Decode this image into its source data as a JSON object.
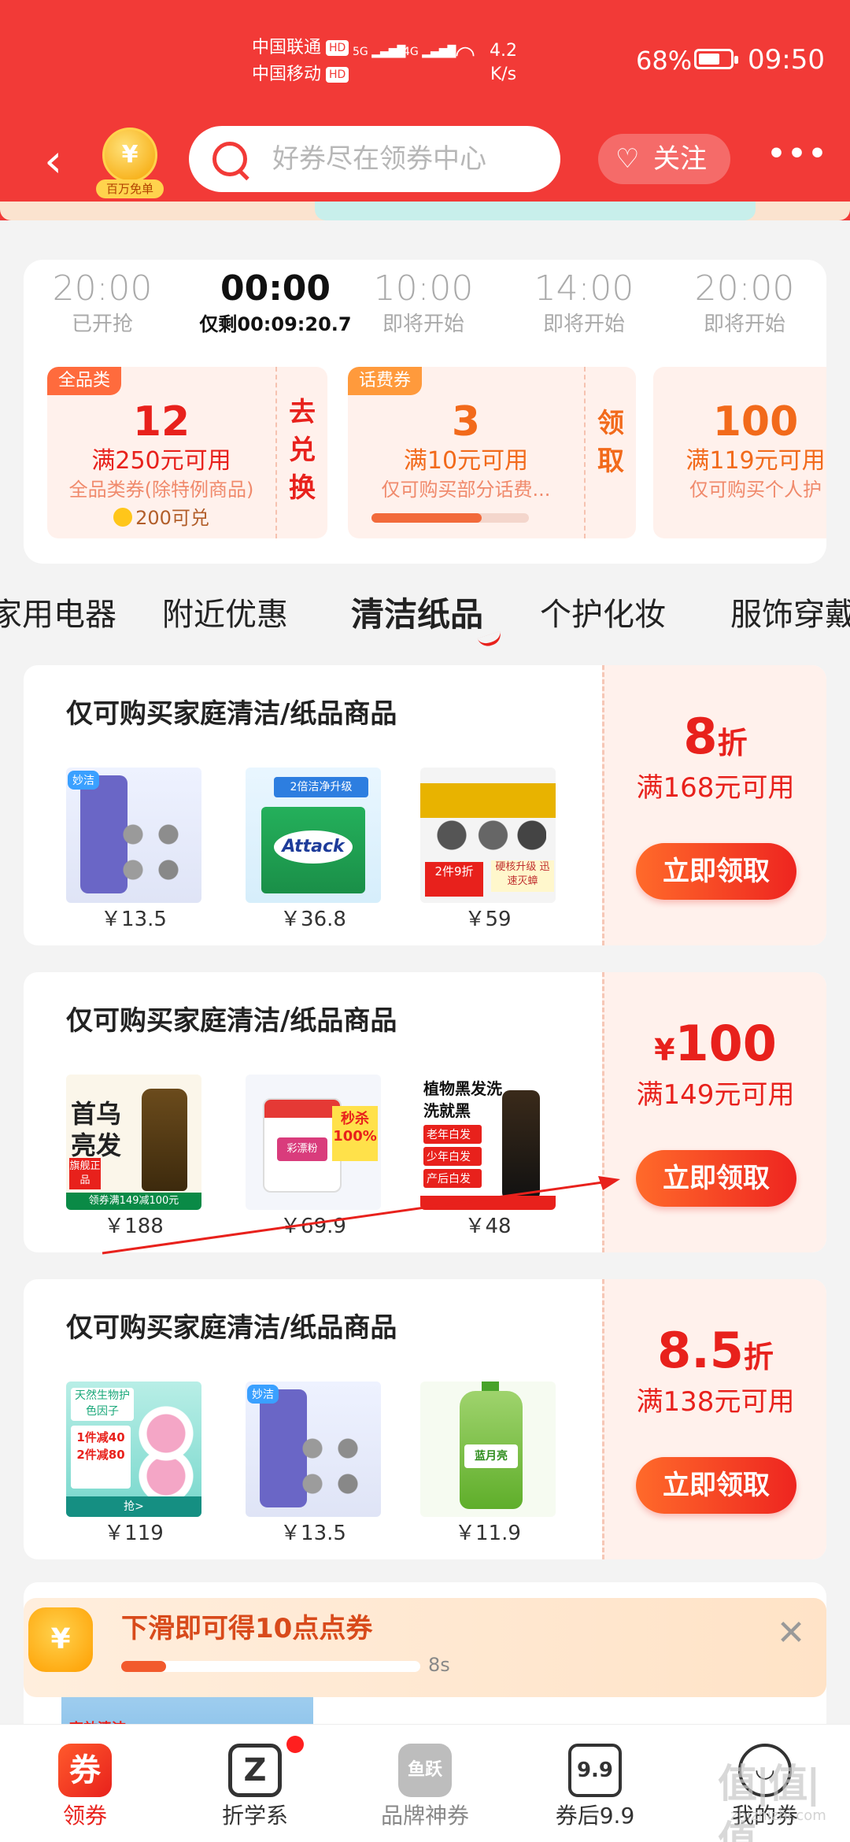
{
  "status": {
    "carrier1": "中国联通",
    "carrier2": "中国移动",
    "hd": "HD",
    "net5g": "5G",
    "net4g": "4G",
    "speed": "4.2",
    "speed_unit": "K/s",
    "battery": "68%",
    "time": "09:50"
  },
  "nav": {
    "badge_label": "百万免单",
    "badge_symbol": "¥",
    "search_placeholder": "好券尽在领券中心",
    "follow_label": "关注",
    "more_label": "•••"
  },
  "flash": {
    "slots": [
      {
        "time": "20:00",
        "status": "已开抢"
      },
      {
        "time": "00:00",
        "status": "仅剩00:09:20.7"
      },
      {
        "time": "10:00",
        "status": "即将开始"
      },
      {
        "time": "14:00",
        "status": "即将开始"
      },
      {
        "time": "20:00",
        "status": "即将开始"
      }
    ],
    "active_index": 1,
    "vouchers": [
      {
        "tag": "全品类",
        "amount": "12",
        "cond": "满250元可用",
        "desc": "全品类券(除特例商品)",
        "points": "200可兑",
        "action": "去兑换"
      },
      {
        "tag": "话费券",
        "amount": "3",
        "cond": "满10元可用",
        "desc": "仅可购买部分话费...",
        "progress": 0.7,
        "action": "领取"
      },
      {
        "tag": "",
        "amount": "100",
        "cond": "满119元可用",
        "desc": "仅可购买个人护"
      }
    ]
  },
  "tabs": {
    "items": [
      "家用电器",
      "附近优惠",
      "清洁纸品",
      "个护化妆",
      "服饰穿戴"
    ],
    "active_index": 2
  },
  "coupons": [
    {
      "title": "仅可购买家庭清洁/纸品商品",
      "value": "8",
      "unit_suffix": "折",
      "unit_prefix": "",
      "cond": "满168元可用",
      "button": "立即领取",
      "products": [
        {
          "price": "￥13.5",
          "img": "steel-wool-pack"
        },
        {
          "price": "￥36.8",
          "img": "attack-detergent"
        },
        {
          "price": "￥59",
          "img": "drain-cleaner"
        }
      ],
      "image_text": {
        "brand": "妙洁",
        "attack": "Attack",
        "attack_hl": "2倍洁净升级",
        "drain_red": "2件9折",
        "drain_ylw": "硬核升级 迅速灭蟑"
      }
    },
    {
      "title": "仅可购买家庭清洁/纸品商品",
      "value": "100",
      "unit_suffix": "",
      "unit_prefix": "¥",
      "cond": "满149元可用",
      "button": "立即领取",
      "products": [
        {
          "price": "￥188",
          "img": "shampoo"
        },
        {
          "price": "￥69.9",
          "img": "bleach-powder"
        },
        {
          "price": "￥48",
          "img": "hair-dye"
        }
      ],
      "image_text": {
        "shampoo": "首乌亮发",
        "shampoo_tag": "旗舰正品",
        "shampoo_strip": "领券满149减100元",
        "bleach": "彩漂粉",
        "bleach_sale": "秒杀100%",
        "dye": "植物黑发洗洗就黑",
        "dye_tags": [
          "老年白发",
          "少年白发",
          "产后白发"
        ]
      }
    },
    {
      "title": "仅可购买家庭清洁/纸品商品",
      "value": "8.5",
      "unit_suffix": "折",
      "unit_prefix": "",
      "cond": "满138元可用",
      "button": "立即领取",
      "products": [
        {
          "price": "￥119",
          "img": "laundry-pods"
        },
        {
          "price": "￥13.5",
          "img": "steel-wool-pack"
        },
        {
          "price": "￥11.9",
          "img": "hand-soap"
        }
      ],
      "image_text": {
        "laundry_head": "天然生物护色因子",
        "laundry_promo": "1件减40 2件减80",
        "laundry_foot": "抢>",
        "brand": "妙洁",
        "soap": "蓝月亮"
      }
    }
  ],
  "banner": {
    "coin": "¥",
    "message": "下滑即可得10点点券",
    "progress": 0.15,
    "seconds": "8s",
    "close": "✕",
    "partial_label": "高效清洁"
  },
  "bottom_nav": {
    "items": [
      {
        "label": "领券",
        "icon": "coupon-tab-icon",
        "glyph": "券"
      },
      {
        "label": "折学系",
        "icon": "z-tab-icon",
        "glyph": "Z"
      },
      {
        "label": "品牌神券",
        "icon": "brand-tab-icon",
        "glyph": "鱼跃"
      },
      {
        "label": "券后9.9",
        "icon": "nine-tab-icon",
        "glyph": "9.9"
      },
      {
        "label": "我的券",
        "icon": "me-tab-icon",
        "glyph": "◡"
      }
    ],
    "active_index": 0
  },
  "watermark": {
    "main": "值|值|值",
    "sub": "zhizhizhi.com"
  },
  "colors": {
    "brand_red": "#f23a37",
    "price_red": "#e8211c",
    "coupon_bg": "#fff1ec"
  }
}
